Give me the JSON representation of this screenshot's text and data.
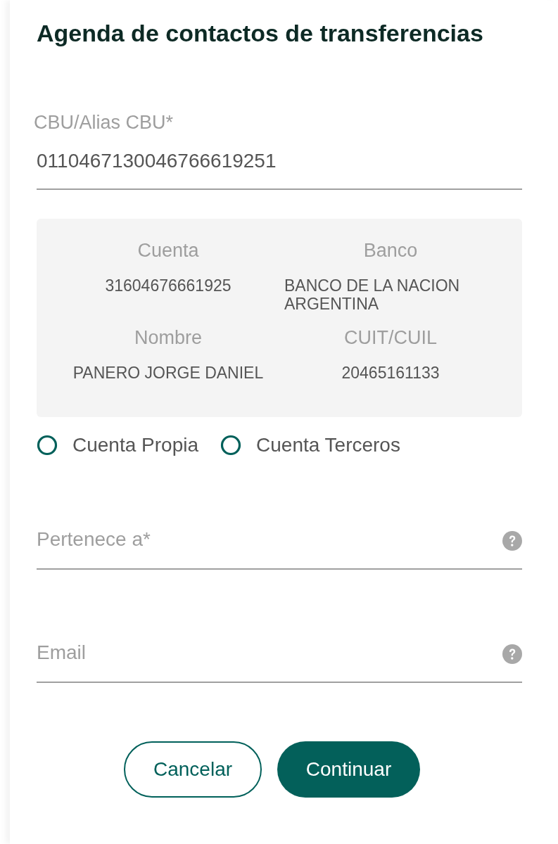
{
  "dialog": {
    "title": "Agenda de contactos de transferencias"
  },
  "cbu_field": {
    "label": "CBU/Alias CBU*",
    "value": "0110467130046766619251"
  },
  "account_details": [
    {
      "label": "Cuenta",
      "value": "31604676661925"
    },
    {
      "label": "Banco",
      "value": "BANCO DE LA NACION ARGENTINA"
    },
    {
      "label": "Nombre",
      "value": "PANERO JORGE DANIEL"
    },
    {
      "label": "CUIT/CUIL",
      "value": "20465161133"
    }
  ],
  "account_type": [
    {
      "label": "Cuenta Propia",
      "selected": false
    },
    {
      "label": "Cuenta Terceros",
      "selected": false
    }
  ],
  "fields": [
    {
      "placeholder": "Pertenece a*"
    },
    {
      "placeholder": "Email"
    }
  ],
  "buttons": [
    {
      "label": "Cancelar",
      "kind": "secondary"
    },
    {
      "label": "Continuar",
      "kind": "primary"
    }
  ]
}
